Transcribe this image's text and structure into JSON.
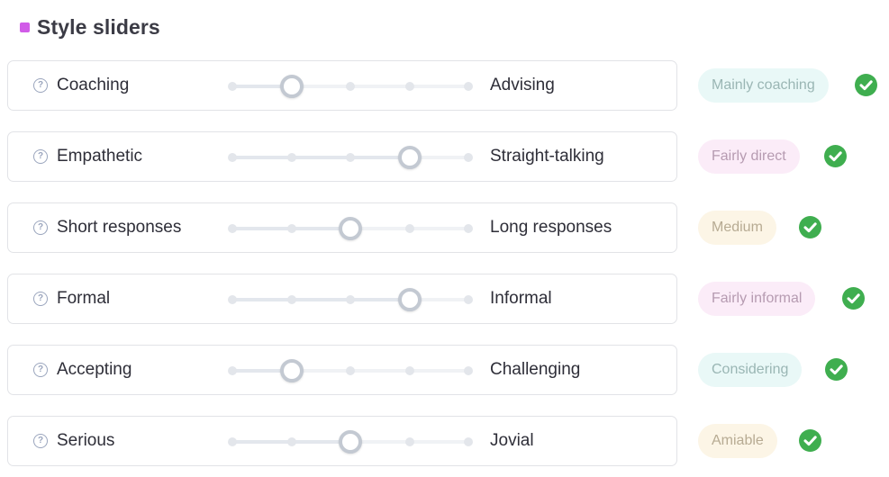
{
  "header": {
    "title": "Style sliders",
    "accent": "#d15ce8"
  },
  "sliders": [
    {
      "left": "Coaching",
      "right": "Advising",
      "value": 1,
      "badge": "Mainly coaching",
      "badge_bg": "#e9f8f7",
      "badge_fg": "#9ab6b4",
      "status": "check-icon"
    },
    {
      "left": "Empathetic",
      "right": "Straight-talking",
      "value": 3,
      "badge": "Fairly direct",
      "badge_bg": "#fbecf8",
      "badge_fg": "#b69bb1",
      "status": "check-icon"
    },
    {
      "left": "Short responses",
      "right": "Long responses",
      "value": 2,
      "badge": "Medium",
      "badge_bg": "#fcf5e6",
      "badge_fg": "#b7ab93",
      "status": "check-icon"
    },
    {
      "left": "Formal",
      "right": "Informal",
      "value": 3,
      "badge": "Fairly informal",
      "badge_bg": "#fbecf8",
      "badge_fg": "#b69bb1",
      "status": "check-icon"
    },
    {
      "left": "Accepting",
      "right": "Challenging",
      "value": 1,
      "badge": "Considering",
      "badge_bg": "#e9f8f7",
      "badge_fg": "#9ab6b4",
      "status": "check-icon"
    },
    {
      "left": "Serious",
      "right": "Jovial",
      "value": 2,
      "badge": "Amiable",
      "badge_bg": "#fcf5e6",
      "badge_fg": "#b7ab93",
      "status": "check-icon"
    }
  ],
  "slider_steps": 5,
  "colors": {
    "check": "#3fae4f",
    "thumb_ring": "#c3c9d2",
    "help_icon": "#9aa5bd"
  }
}
